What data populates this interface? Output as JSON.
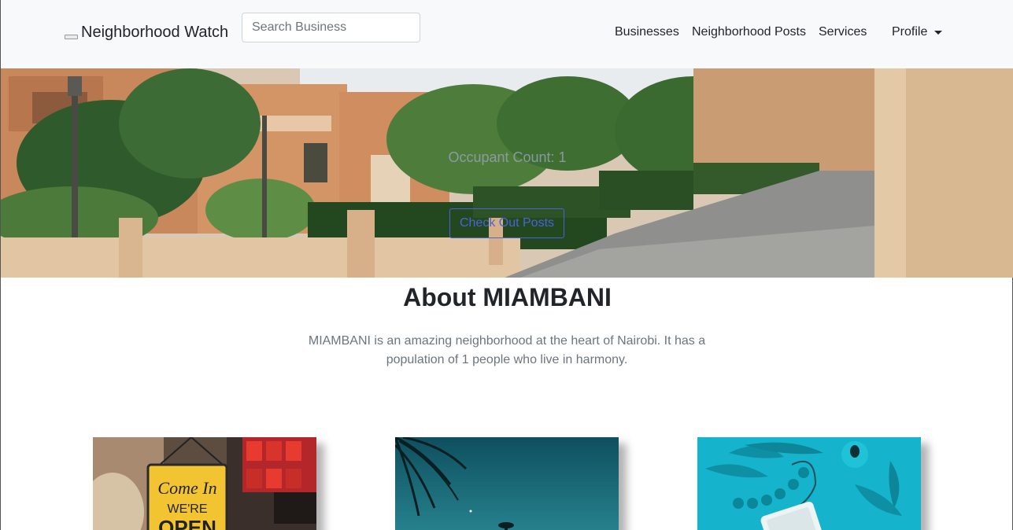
{
  "navbar": {
    "brand": "Neighborhood Watch",
    "search_placeholder": "Search Business",
    "links": [
      "Businesses",
      "Neighborhood Posts",
      "Services"
    ],
    "profile_label": "Profile"
  },
  "hero": {
    "occupant_count_text": "Occupant Count: 1",
    "button_label": "Check Out Posts"
  },
  "about": {
    "title": "About MIAMBANI",
    "description": "MIAMBANI is an amazing neighborhood at the heart of Nairobi. It has a population of 1 people who live in harmony."
  },
  "cards": {
    "shop_sign_line1": "Come In",
    "shop_sign_line2": "WE'RE",
    "shop_sign_line3": "OPEN"
  },
  "colors": {
    "navbar_bg": "#f8f9fa",
    "button_accent": "#4a63d8",
    "muted_text": "#6c757d",
    "teal_card": "#16b4cc"
  }
}
